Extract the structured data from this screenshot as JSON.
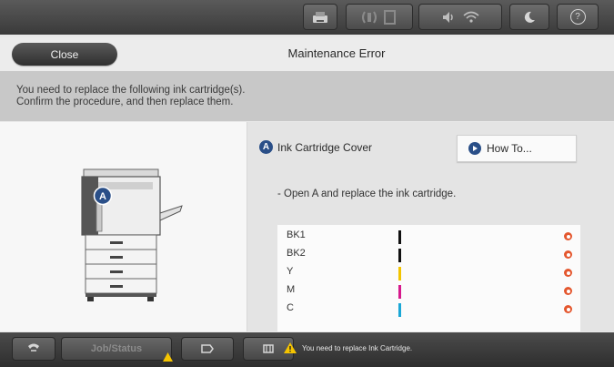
{
  "topbar": {
    "icons": [
      "printer-network-icon",
      "wifi-direct-icon",
      "document-icon",
      "volume-icon",
      "wifi-icon",
      "sleep-moon-icon",
      "help-icon"
    ],
    "help_label": "?"
  },
  "header": {
    "close_label": "Close",
    "title": "Maintenance Error"
  },
  "message": {
    "line1": "You need to replace the following ink cartridge(s).",
    "line2": "Confirm the procedure, and then replace them."
  },
  "illustration": {
    "badge": "A"
  },
  "cover": {
    "badge": "A",
    "label": "Ink Cartridge Cover"
  },
  "howto": {
    "label": "How To..."
  },
  "instruction": "- Open A and replace the ink cartridge.",
  "inks": [
    {
      "name": "BK1",
      "color": "#111111"
    },
    {
      "name": "BK2",
      "color": "#111111"
    },
    {
      "name": "Y",
      "color": "#f2c400"
    },
    {
      "name": "M",
      "color": "#d6198c"
    },
    {
      "name": "C",
      "color": "#1aa7d6"
    }
  ],
  "colors": {
    "accent_blue": "#2a4f88",
    "warning_orange": "#e4572e",
    "warning_yellow": "#f5c400"
  },
  "bottombar": {
    "job_status_label": "Job/Status",
    "status_message": "You need to replace Ink Cartridge."
  }
}
